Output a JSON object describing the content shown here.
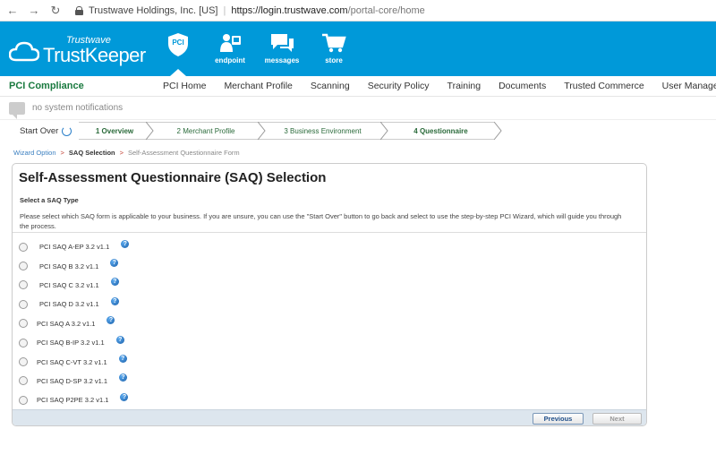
{
  "browser": {
    "site_name": "Trustwave Holdings, Inc. [US]",
    "separator": "|",
    "url_host": "https://login.trustwave.com",
    "url_path": "/portal-core/home"
  },
  "header": {
    "logo_small": "Trustwave",
    "logo_big": "TrustKeeper",
    "icons": [
      {
        "label": "PCI",
        "icon": "pci-shield-icon"
      },
      {
        "label": "endpoint",
        "icon": "endpoint-icon"
      },
      {
        "label": "messages",
        "icon": "messages-icon"
      },
      {
        "label": "store",
        "icon": "cart-icon"
      }
    ]
  },
  "nav": {
    "brand": "PCI Compliance",
    "items": [
      "PCI Home",
      "Merchant Profile",
      "Scanning",
      "Security Policy",
      "Training",
      "Documents",
      "Trusted Commerce",
      "User Manageme"
    ]
  },
  "notifications": {
    "text": "no system notifications"
  },
  "steps": {
    "start_over": "Start Over",
    "items": [
      {
        "label": "1 Overview"
      },
      {
        "label": "2 Merchant Profile"
      },
      {
        "label": "3 Business Environment"
      },
      {
        "label": "4 Questionnaire"
      }
    ]
  },
  "breadcrumb": {
    "wizard": "Wizard Option",
    "saq_selection": "SAQ Selection",
    "form": "Self-Assessment Questionnaire Form",
    "arrow": ">"
  },
  "panel": {
    "title": "Self-Assessment Questionnaire (SAQ) Selection",
    "subtitle": "Select a SAQ Type",
    "description": "Please select which SAQ form is applicable to your business. If you are unsure, you can use the \"Start Over\" button to go back and select to use the step-by-step PCI Wizard, which will guide you through the process.",
    "options": [
      "PCI SAQ A-EP 3.2 v1.1",
      "PCI SAQ B 3.2 v1.1",
      "PCI SAQ C 3.2 v1.1",
      "PCI SAQ D 3.2 v1.1",
      "PCI SAQ A 3.2 v1.1",
      "PCI SAQ B-IP 3.2 v1.1",
      "PCI SAQ C-VT 3.2 v1.1",
      "PCI SAQ D-SP 3.2 v1.1",
      "PCI SAQ P2PE 3.2 v1.1"
    ],
    "help_glyph": "?",
    "previous": "Previous",
    "next": "Next"
  },
  "colors": {
    "header_blue": "#0099d9",
    "brand_green": "#1a7a3f"
  }
}
